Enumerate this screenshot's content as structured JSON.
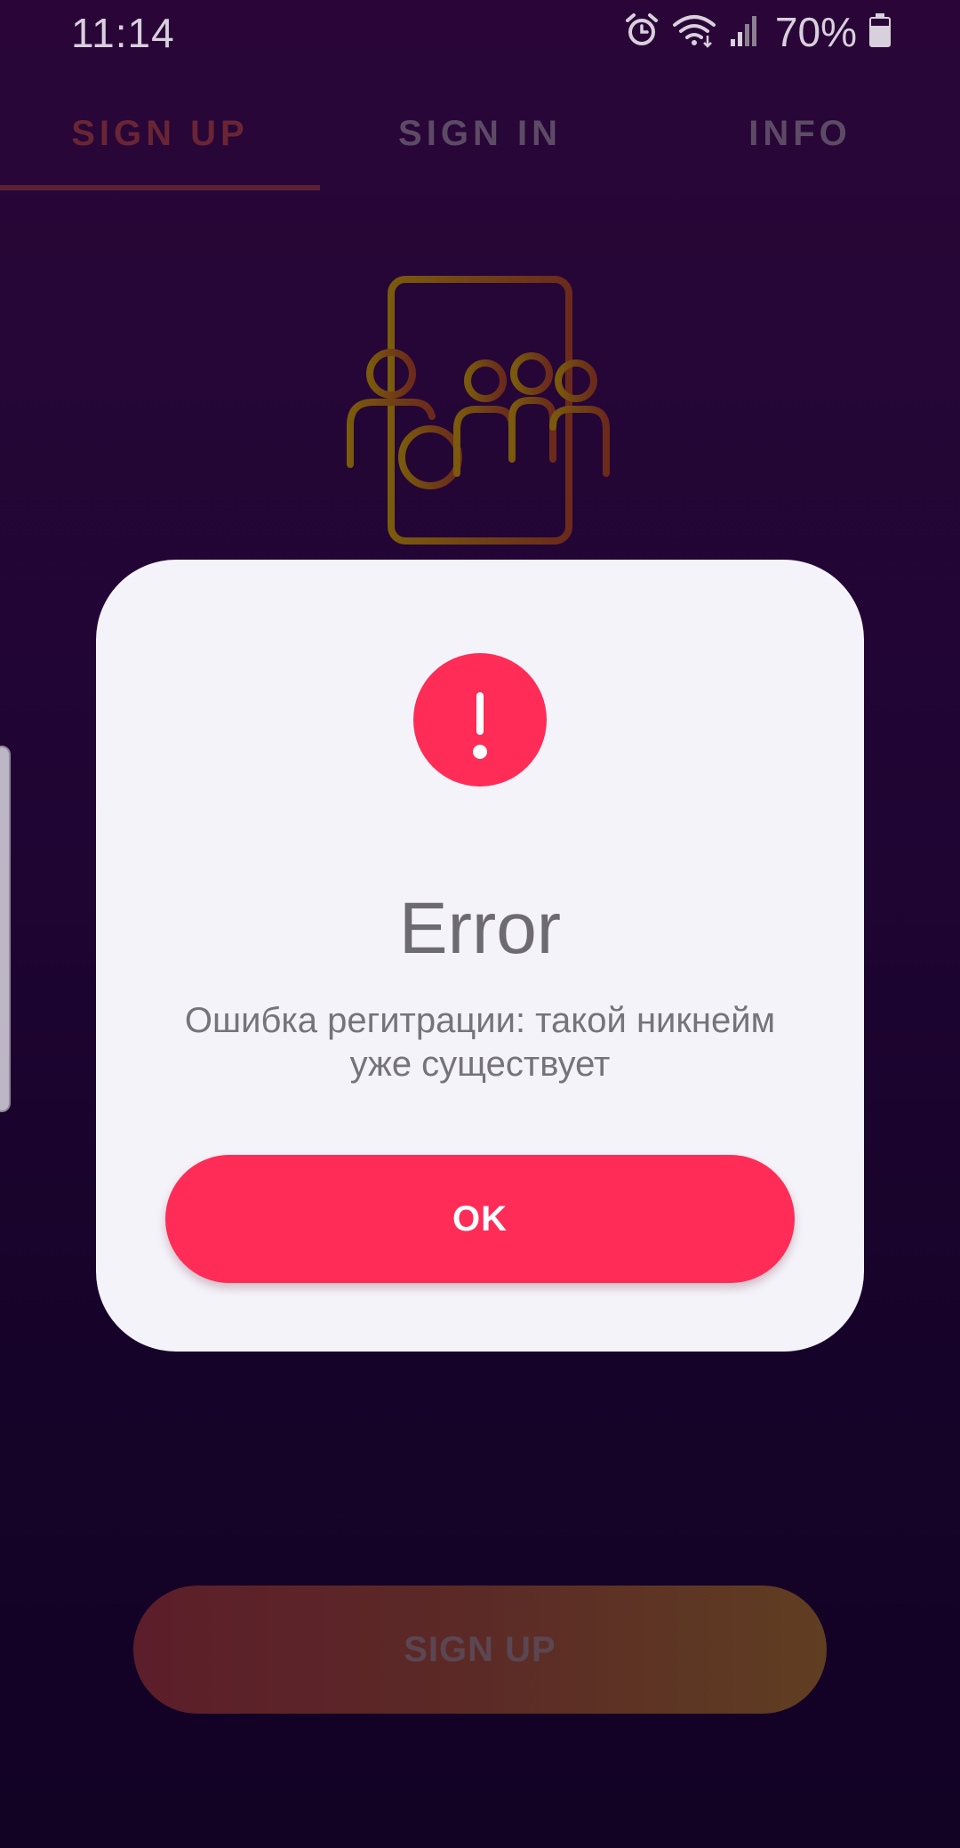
{
  "status_bar": {
    "time": "11:14",
    "battery": "70%",
    "icons": [
      "alarm-icon",
      "wifi-icon",
      "signal-icon",
      "battery-icon"
    ]
  },
  "tabs": [
    {
      "label": "SIGN UP",
      "active": true
    },
    {
      "label": "SIGN IN",
      "active": false
    },
    {
      "label": "INFO",
      "active": false
    }
  ],
  "hero": {
    "icon": "phone-users-add-icon"
  },
  "dialog": {
    "icon": "exclamation-icon",
    "title": "Error",
    "message": "Ошибка регитрации: такой никнейм уже существует",
    "ok_label": "OK"
  },
  "signup_button": {
    "label": "SIGN UP"
  },
  "colors": {
    "accent": "#fe2c57",
    "dialog_bg": "#f4f3fa",
    "background": "#1f0533"
  }
}
